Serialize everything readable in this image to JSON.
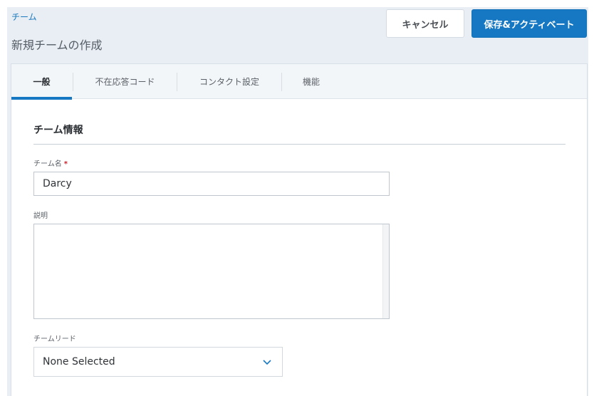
{
  "breadcrumb": {
    "label": "チーム"
  },
  "header": {
    "title": "新規チームの作成",
    "cancel_label": "キャンセル",
    "save_label": "保存&アクティベート"
  },
  "tabs": [
    {
      "label": "一般",
      "active": true
    },
    {
      "label": "不在応答コード",
      "active": false
    },
    {
      "label": "コンタクト設定",
      "active": false
    },
    {
      "label": "機能",
      "active": false
    }
  ],
  "form": {
    "section_title": "チーム情報",
    "team_name": {
      "label": "チーム名",
      "required_mark": "*",
      "value": "Darcy"
    },
    "description": {
      "label": "説明",
      "value": ""
    },
    "team_lead": {
      "label": "チームリード",
      "selected": "None Selected"
    }
  },
  "colors": {
    "accent": "#1678c2",
    "required": "#d0222e",
    "page_bg": "#e9eef4"
  },
  "icons": {
    "team_lead_dropdown": "chevron-down-icon"
  }
}
